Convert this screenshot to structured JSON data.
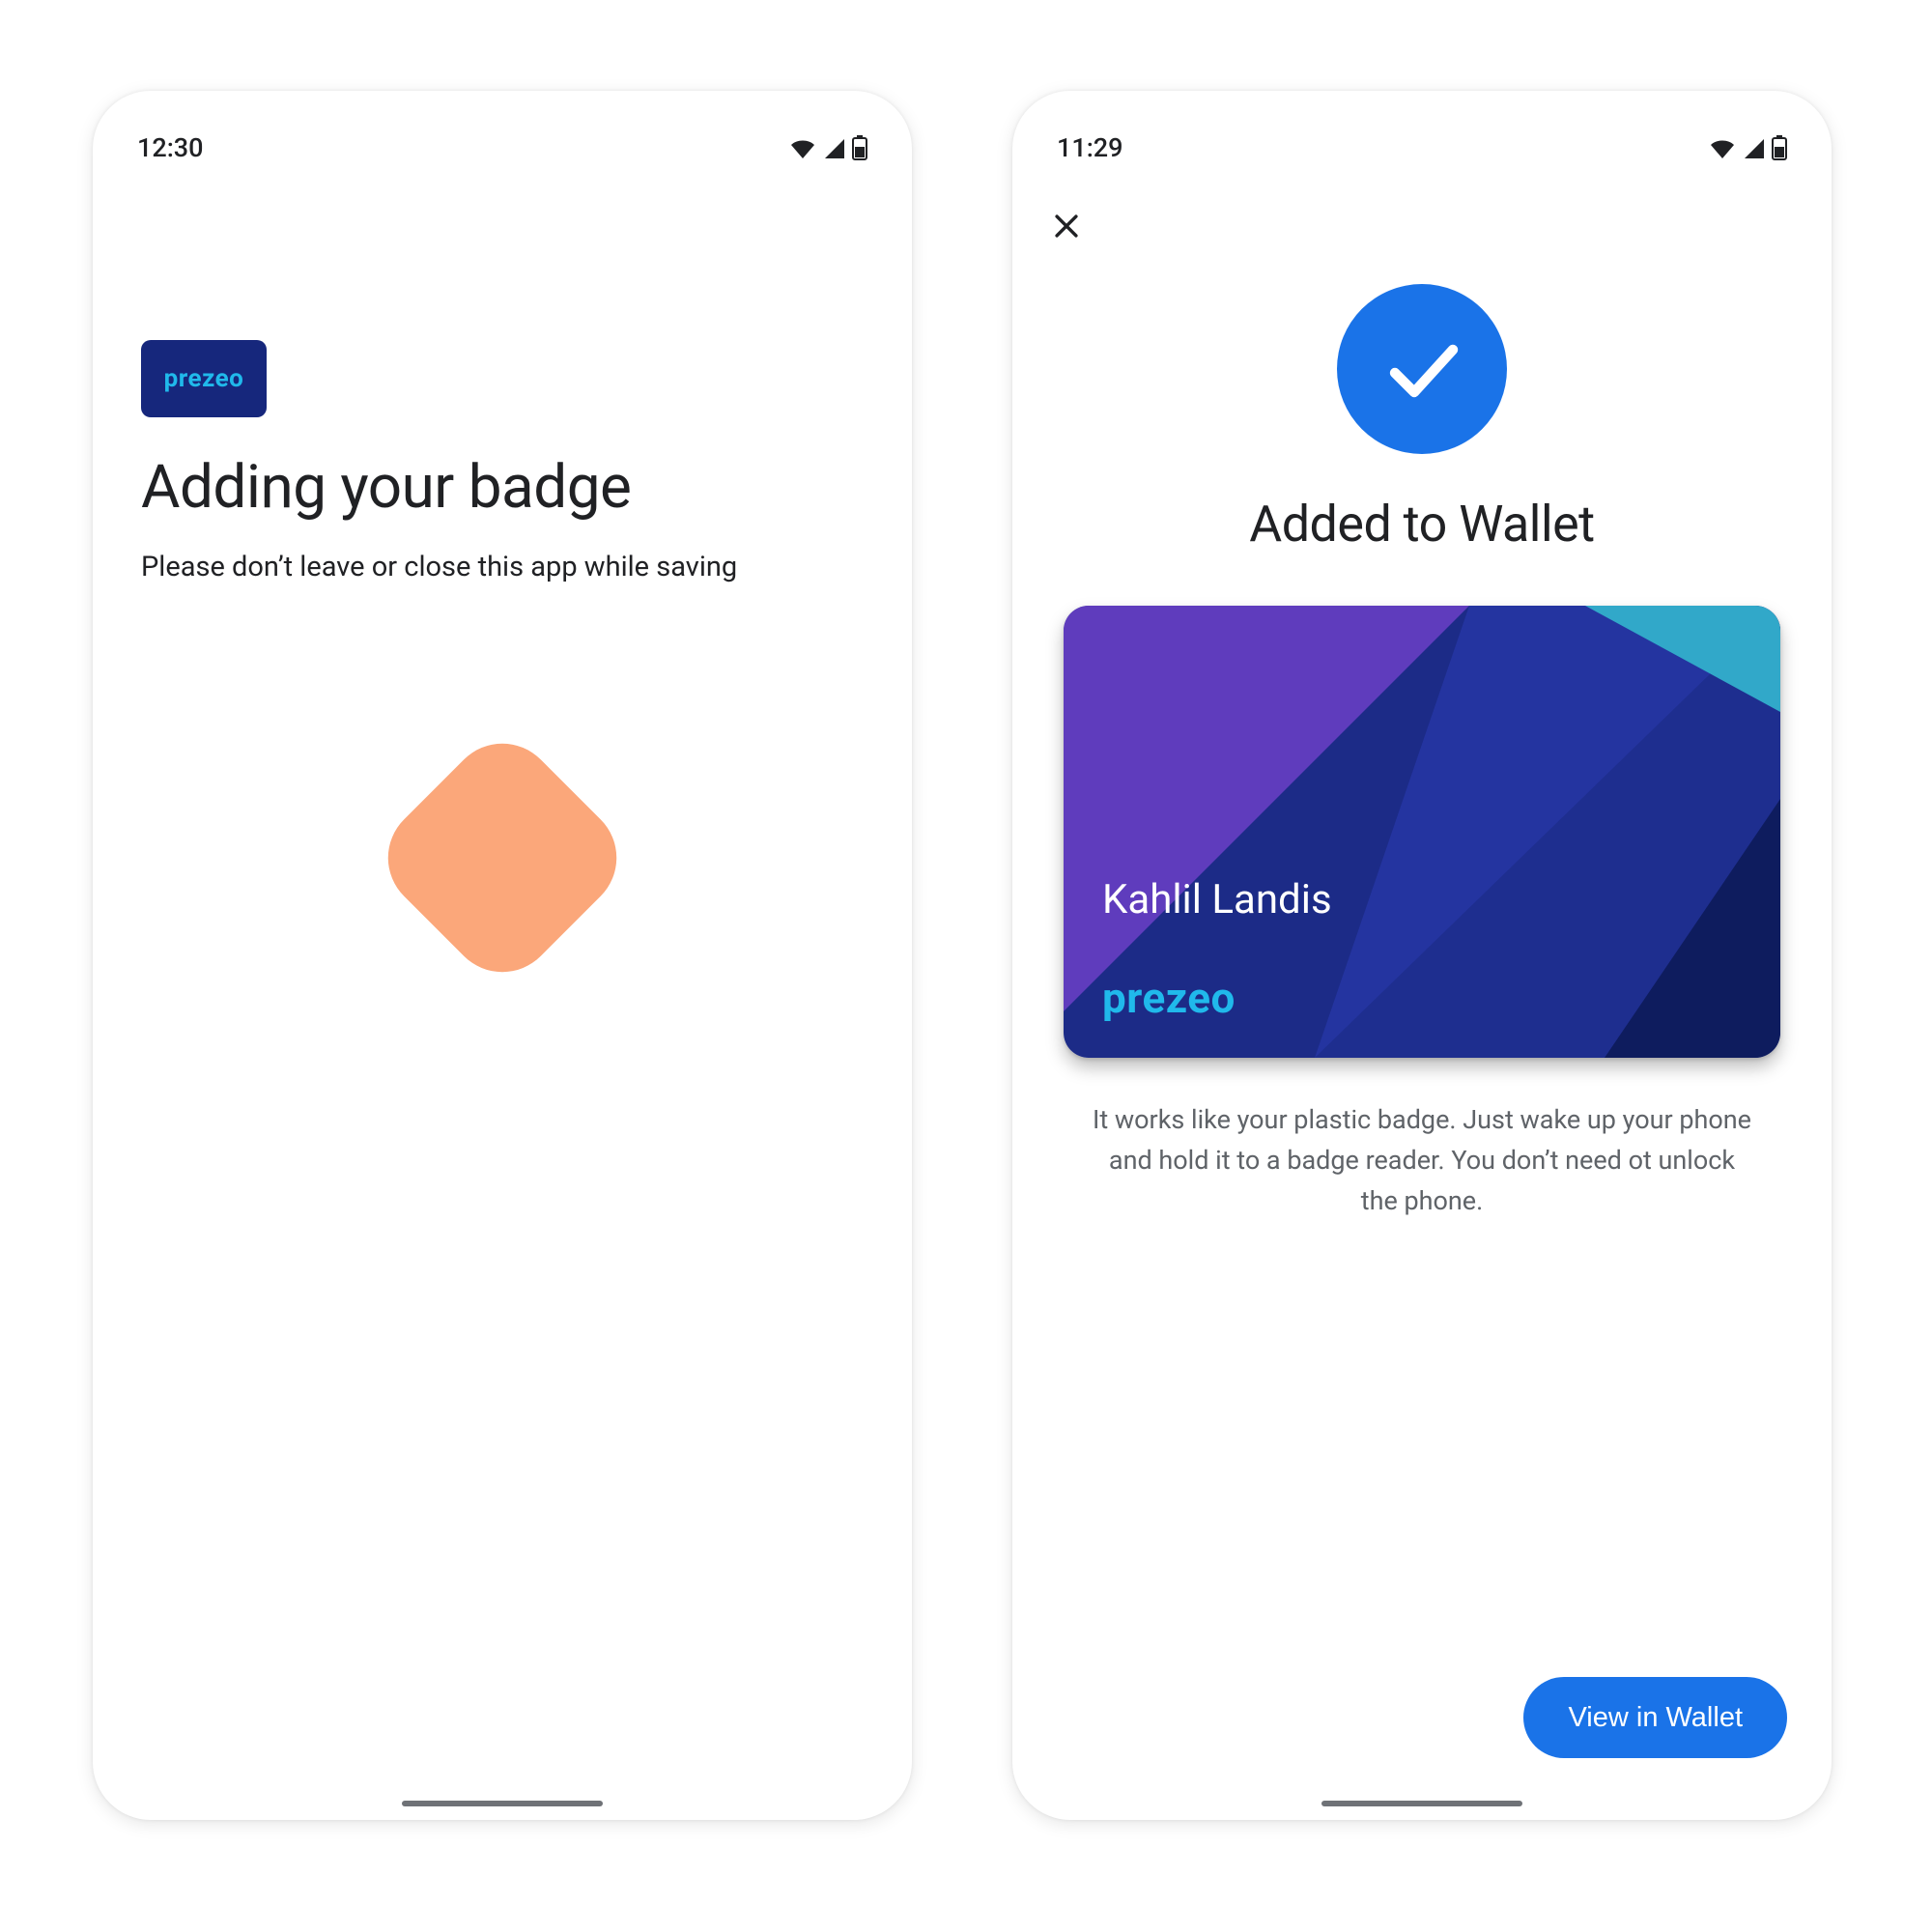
{
  "left": {
    "status": {
      "time": "12:30"
    },
    "brand_label": "prezeo",
    "title": "Adding your badge",
    "subtitle": "Please don’t leave or close this app while saving"
  },
  "right": {
    "status": {
      "time": "11:29"
    },
    "title": "Added to Wallet",
    "card": {
      "holder_name": "Kahlil Landis",
      "brand_label": "prezeo"
    },
    "info": "It works like your plastic badge. Just wake up your phone and hold it to a badge reader. You don’t need ot unlock the phone.",
    "cta_label": "View in Wallet"
  },
  "colors": {
    "brand_blue": "#1A73E8",
    "brand_navy": "#16277C",
    "brand_cyan": "#20B9EB",
    "spinner": "#FBA77A"
  }
}
